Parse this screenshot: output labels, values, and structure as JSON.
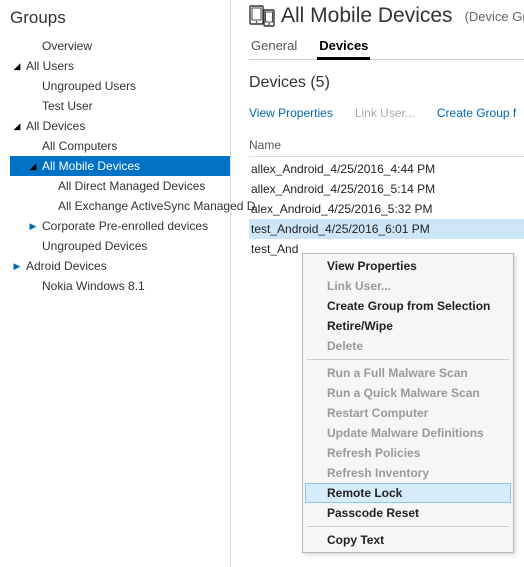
{
  "sidebar": {
    "title": "Groups",
    "items": [
      {
        "label": "Overview",
        "arrow": "",
        "indent": 1
      },
      {
        "label": "All Users",
        "arrow": "down",
        "indent": 0
      },
      {
        "label": "Ungrouped Users",
        "arrow": "",
        "indent": 1
      },
      {
        "label": "Test User",
        "arrow": "",
        "indent": 1
      },
      {
        "label": "All Devices",
        "arrow": "down",
        "indent": 0
      },
      {
        "label": "All Computers",
        "arrow": "",
        "indent": 1
      },
      {
        "label": "All Mobile Devices",
        "arrow": "down",
        "indent": 1,
        "selected": true
      },
      {
        "label": "All Direct Managed Devices",
        "arrow": "",
        "indent": 2
      },
      {
        "label": "All Exchange ActiveSync Managed D",
        "arrow": "",
        "indent": 2
      },
      {
        "label": "Corporate Pre-enrolled devices",
        "arrow": "right",
        "indent": 1
      },
      {
        "label": "Ungrouped Devices",
        "arrow": "",
        "indent": 1
      },
      {
        "label": "Adroid Devices",
        "arrow": "right",
        "indent": 0
      },
      {
        "label": "Nokia Windows 8.1",
        "arrow": "",
        "indent": 1
      }
    ]
  },
  "header": {
    "title": "All Mobile Devices",
    "subtitle": "(Device Grou"
  },
  "tabs": [
    {
      "label": "General"
    },
    {
      "label": "Devices",
      "active": true
    }
  ],
  "section_heading": "Devices (5)",
  "action_links": [
    {
      "label": "View Properties",
      "disabled": false
    },
    {
      "label": "Link User...",
      "disabled": true
    },
    {
      "label": "Create Group f",
      "disabled": false
    }
  ],
  "table": {
    "column": "Name",
    "rows": [
      {
        "text": "allex_Android_4/25/2016_4:44 PM"
      },
      {
        "text": "allex_Android_4/25/2016_5:14 PM"
      },
      {
        "text": "alex_Android_4/25/2016_5:32 PM"
      },
      {
        "text": "test_Android_4/25/2016_6:01 PM",
        "selected": true
      },
      {
        "text": "test_And"
      }
    ]
  },
  "context_menu": [
    {
      "label": "View Properties"
    },
    {
      "label": "Link User...",
      "disabled": true
    },
    {
      "label": "Create Group from Selection"
    },
    {
      "label": "Retire/Wipe"
    },
    {
      "label": "Delete",
      "disabled": true
    },
    {
      "sep": true
    },
    {
      "label": "Run a Full Malware Scan",
      "disabled": true
    },
    {
      "label": "Run a Quick Malware Scan",
      "disabled": true
    },
    {
      "label": "Restart Computer",
      "disabled": true
    },
    {
      "label": "Update Malware Definitions",
      "disabled": true
    },
    {
      "label": "Refresh Policies",
      "disabled": true
    },
    {
      "label": "Refresh Inventory",
      "disabled": true
    },
    {
      "label": "Remote Lock",
      "hover": true
    },
    {
      "label": "Passcode Reset"
    },
    {
      "sep": true
    },
    {
      "label": "Copy Text"
    }
  ]
}
